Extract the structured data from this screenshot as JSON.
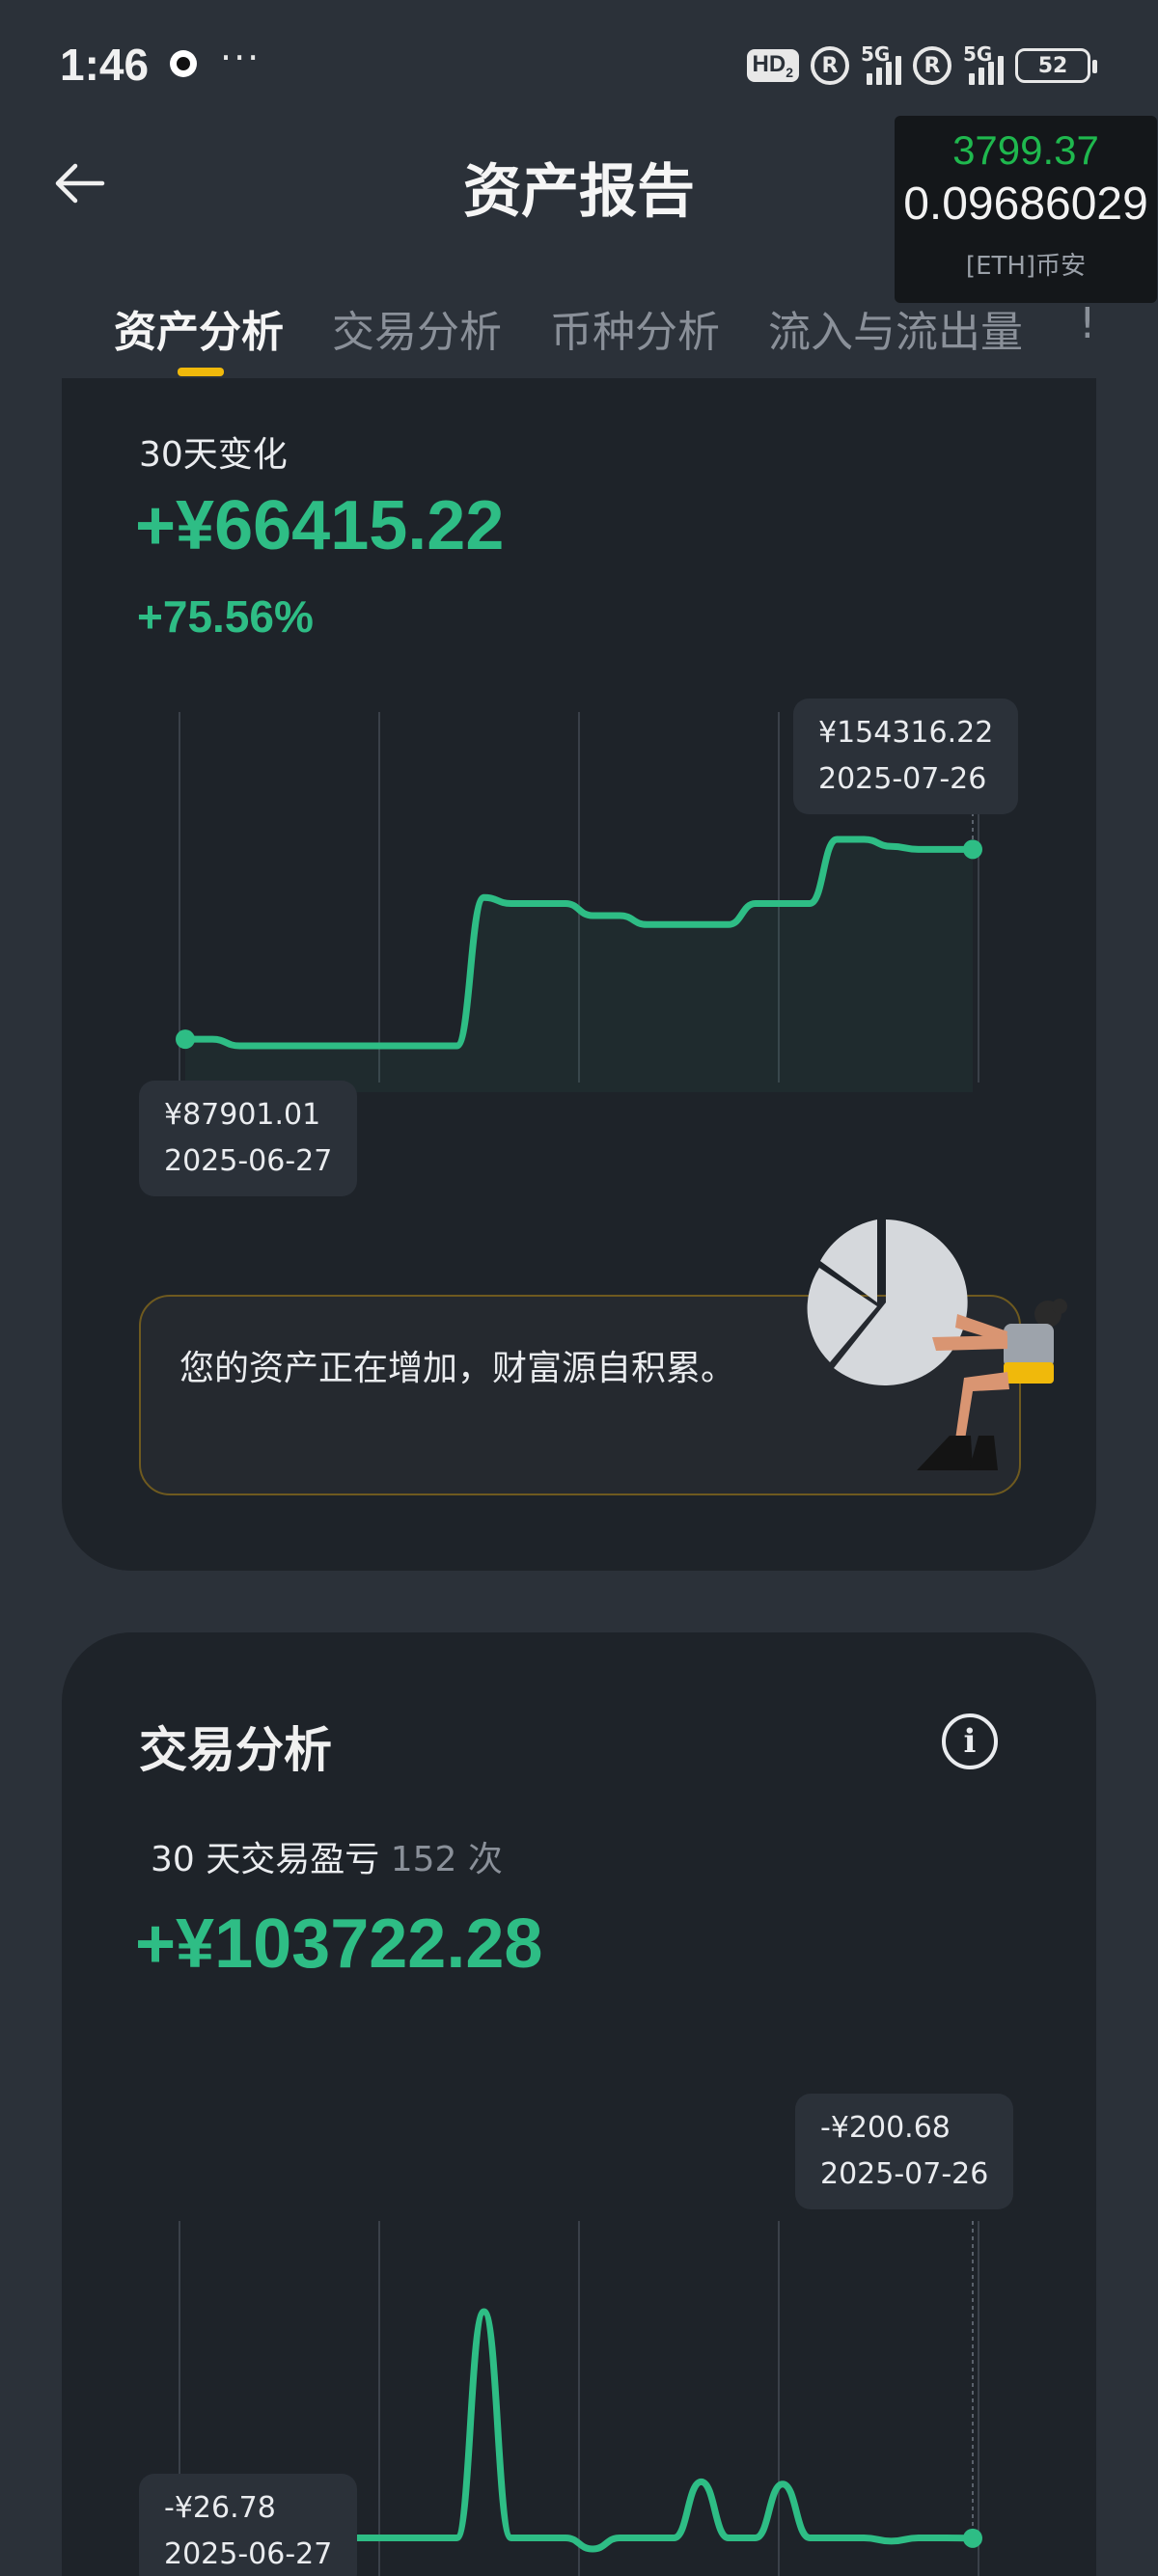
{
  "status_bar": {
    "time": "1:46",
    "dots": "···",
    "hd": "HD",
    "hd_sub": "2",
    "r1": "R",
    "net1": "5G",
    "r2": "R",
    "net2": "5G",
    "battery": "52",
    "icons": [
      "qq-icon",
      "hd-icon",
      "registered-icon",
      "signal-icon",
      "battery-icon"
    ]
  },
  "header": {
    "title": "资产报告",
    "back_icon": "arrow-left-icon"
  },
  "ticker_widget": {
    "price": "3799.37",
    "amount": "0.09686029",
    "source": "[ETH]币安"
  },
  "tabs": [
    {
      "label": "资产分析",
      "active": true
    },
    {
      "label": "交易分析",
      "active": false
    },
    {
      "label": "币种分析",
      "active": false
    },
    {
      "label": "流入与流出量",
      "active": false
    }
  ],
  "tab_overflow": "!",
  "asset_card": {
    "label": "30天变化",
    "change_value": "+¥66415.22",
    "change_percent": "+75.56%",
    "start_tooltip": {
      "value": "¥87901.01",
      "date": "2025-06-27"
    },
    "end_tooltip": {
      "value": "¥154316.22",
      "date": "2025-07-26"
    },
    "message": "您的资产正在增加，财富源自积累。",
    "illustration": "pie-chart-person-illustration"
  },
  "trade_card": {
    "title": "交易分析",
    "info_icon": "info-icon",
    "info_glyph": "i",
    "label": "30 天交易盈亏",
    "count": "152 次",
    "pnl_value": "+¥103722.28",
    "start_tooltip": {
      "value": "-¥26.78",
      "date": "2025-06-27"
    },
    "end_tooltip": {
      "value": "-¥200.68",
      "date": "2025-07-26"
    }
  },
  "colors": {
    "accent_green": "#2ebd85",
    "tab_indicator": "#f0b90b",
    "card_bg": "#1e2329",
    "page_bg": "#2b3139"
  },
  "chart_data": [
    {
      "type": "line",
      "title": "",
      "xlabel": "",
      "ylabel": "",
      "x_range": [
        "2025-06-27",
        "2025-07-26"
      ],
      "series": [
        {
          "values": [
            87901,
            87901,
            85700,
            85700,
            85700,
            85700,
            85700,
            85700,
            85700,
            85700,
            85700,
            135000,
            133000,
            133000,
            133000,
            129000,
            129000,
            126000,
            126000,
            126000,
            126000,
            133000,
            133000,
            133000,
            154316,
            154316,
            152000,
            151000,
            151000,
            151000
          ]
        }
      ],
      "grid": "vertical"
    },
    {
      "type": "line",
      "title": "",
      "xlabel": "",
      "ylabel": "",
      "x_range": [
        "2025-06-27",
        "2025-07-26"
      ],
      "series": [
        {
          "values": [
            -27,
            -27,
            -27,
            -27,
            -27,
            -27,
            -27,
            -27,
            -27,
            -27,
            -27,
            101000,
            -27,
            -27,
            -27,
            -5000,
            -27,
            -27,
            -27,
            25000,
            -27,
            -27,
            24000,
            -27,
            -27,
            -27,
            -1500,
            -27,
            -27,
            -201
          ]
        }
      ],
      "grid": "vertical"
    }
  ]
}
